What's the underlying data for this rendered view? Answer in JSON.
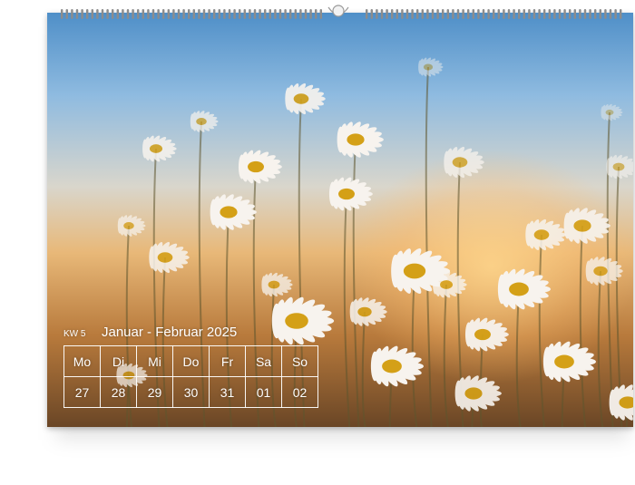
{
  "calendar": {
    "week_label": "KW 5",
    "month_title": "Januar - Februar 2025",
    "weekdays": [
      "Mo",
      "Di",
      "Mi",
      "Do",
      "Fr",
      "Sa",
      "So"
    ],
    "days": [
      "27",
      "28",
      "29",
      "30",
      "31",
      "01",
      "02"
    ]
  },
  "icons": {
    "binding": "wire-binding-icon",
    "hanger": "hanger-hook-icon"
  }
}
